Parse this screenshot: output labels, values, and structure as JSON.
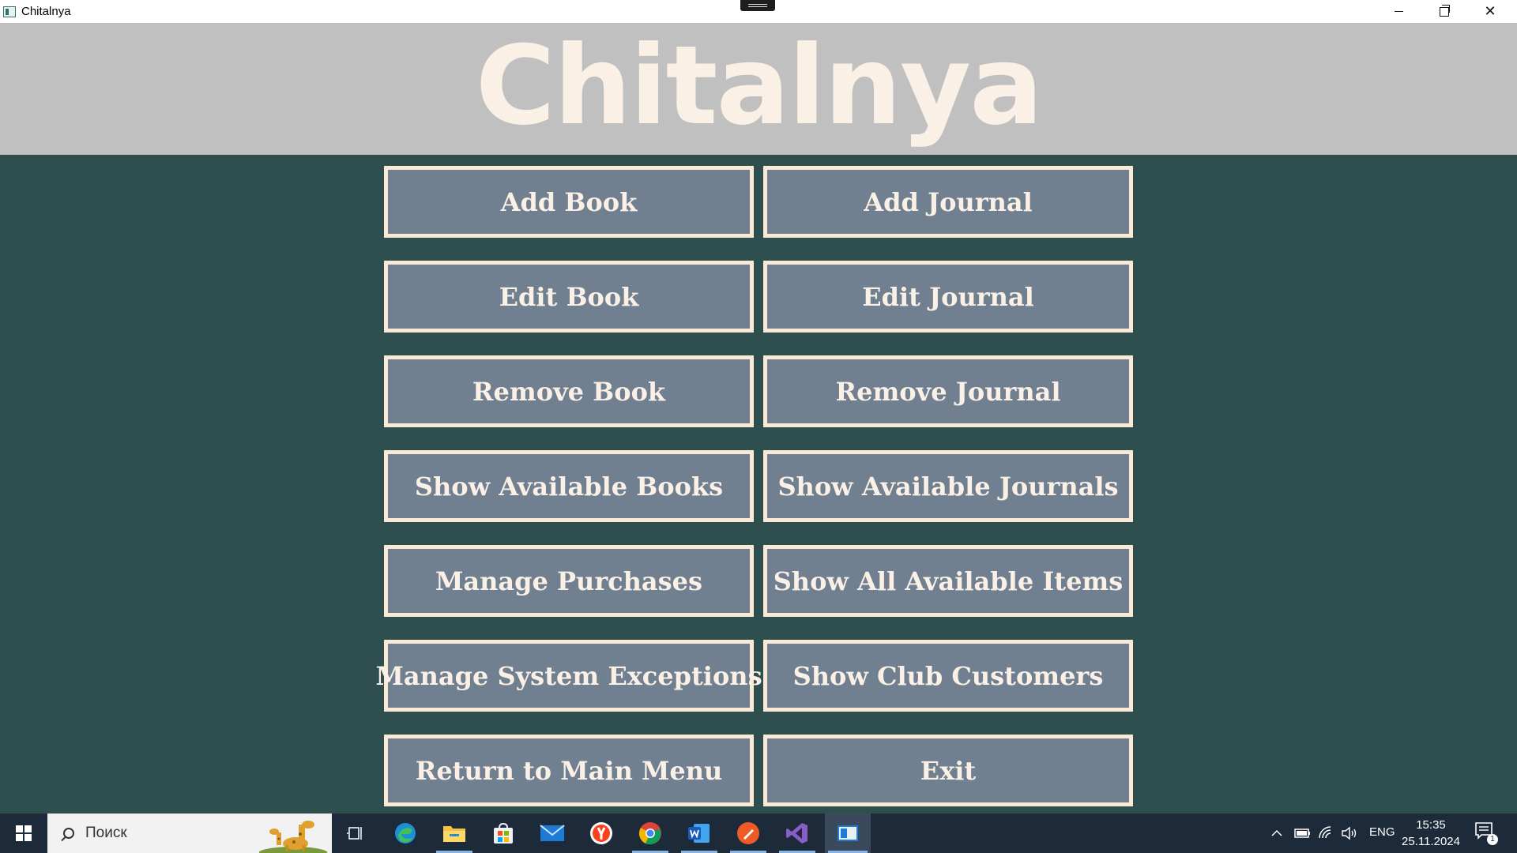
{
  "window": {
    "title": "Chitalnya",
    "controls": [
      "minimize-icon",
      "restore-icon",
      "close-icon"
    ],
    "close_glyph": "✕"
  },
  "header": {
    "title": "Chitalnya"
  },
  "menu": {
    "buttons": [
      "Add Book",
      "Add Journal",
      "Edit Book",
      "Edit Journal",
      "Remove Book",
      "Remove Journal",
      "Show Available Books",
      "Show Available Journals",
      "Manage Purchases",
      "Show All Available Items",
      "Manage System Exceptions",
      "Show Club Customers",
      "Return to Main Menu",
      "Exit"
    ]
  },
  "taskbar": {
    "search_placeholder": "Поиск",
    "pinned_icons": [
      "task-view-icon",
      "edge-icon",
      "file-explorer-icon",
      "microsoft-store-icon",
      "mail-icon",
      "yandex-browser-icon",
      "chrome-icon",
      "word-icon",
      "postman-icon",
      "visual-studio-icon",
      "chitalnya-app-icon"
    ],
    "language": "ENG",
    "time": "15:35",
    "date": "25.11.2024",
    "notification_count": "1"
  },
  "colors": {
    "background": "#2f4f4f",
    "header_background": "#c0c0c0",
    "title_text": "#faf0e6",
    "button_fill": "#708090",
    "button_border": "#faebd7",
    "taskbar": "#1c2a3a"
  }
}
